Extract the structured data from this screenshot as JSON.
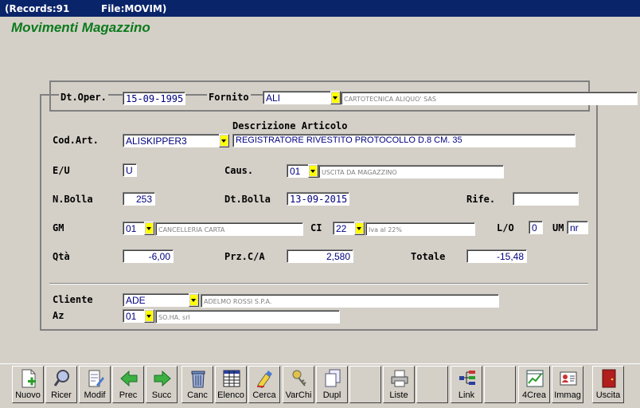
{
  "titlebar": {
    "records": "(Records:91",
    "file": "File:MOVIM)"
  },
  "app_title": "Movimenti Magazzino",
  "form": {
    "dt_oper": {
      "label": "Dt.Oper.",
      "value": "15-09-1995"
    },
    "fornito": {
      "label": "Fornito",
      "code": "ALI",
      "desc": "CARTOTECNICA ALIQUO' SAS"
    },
    "descr_label": "Descrizione Articolo",
    "cod_art": {
      "label": "Cod.Art.",
      "code": "ALISKIPPER3",
      "desc": "REGISTRATORE RIVESTITO PROTOCOLLO D.8 CM. 35"
    },
    "eu": {
      "label": "E/U",
      "value": "U"
    },
    "caus": {
      "label": "Caus.",
      "code": "01",
      "desc": "USCITA DA MAGAZZINO"
    },
    "n_bolla": {
      "label": "N.Bolla",
      "value": "253"
    },
    "dt_bolla": {
      "label": "Dt.Bolla",
      "value": "13-09-2015"
    },
    "rife": {
      "label": "Rife.",
      "value": ""
    },
    "gm": {
      "label": "GM",
      "code": "01",
      "desc": "CANCELLERIA CARTA"
    },
    "ci": {
      "label": "CI",
      "code": "22",
      "desc": "Iva al 22%"
    },
    "lo": {
      "label": "L/O",
      "value": "0"
    },
    "um": {
      "label": "UM",
      "value": "nr"
    },
    "qta": {
      "label": "Qtà",
      "value": "-6,00"
    },
    "prz": {
      "label": "Prz.C/A",
      "value": "2,580"
    },
    "totale": {
      "label": "Totale",
      "value": "-15,48"
    },
    "cliente": {
      "label": "Cliente",
      "code": "ADE",
      "desc": "ADELMO ROSSI S.P.A."
    },
    "az": {
      "label": "Az",
      "code": "01",
      "desc": "SO.HA. srl"
    }
  },
  "toolbar": [
    {
      "label": "Nuovo",
      "icon": "new-document-icon"
    },
    {
      "label": "Ricer",
      "icon": "search-icon"
    },
    {
      "label": "Modif",
      "icon": "edit-icon"
    },
    {
      "label": "Prec",
      "icon": "arrow-left-icon"
    },
    {
      "label": "Succ",
      "icon": "arrow-right-icon"
    },
    {
      "label": "Canc",
      "icon": "trash-icon"
    },
    {
      "label": "Elenco",
      "icon": "table-icon"
    },
    {
      "label": "Cerca",
      "icon": "highlighter-icon"
    },
    {
      "label": "VarChi",
      "icon": "keys-icon"
    },
    {
      "label": "Dupl",
      "icon": "duplicate-icon"
    },
    {
      "label": "",
      "icon": ""
    },
    {
      "label": "Liste",
      "icon": "printer-icon"
    },
    {
      "label": "",
      "icon": ""
    },
    {
      "label": "Link",
      "icon": "link-tree-icon"
    },
    {
      "label": "",
      "icon": ""
    },
    {
      "label": "4Crea",
      "icon": "chart-icon"
    },
    {
      "label": "Immag",
      "icon": "id-card-icon"
    },
    {
      "label": "Uscita",
      "icon": "exit-door-icon"
    }
  ]
}
